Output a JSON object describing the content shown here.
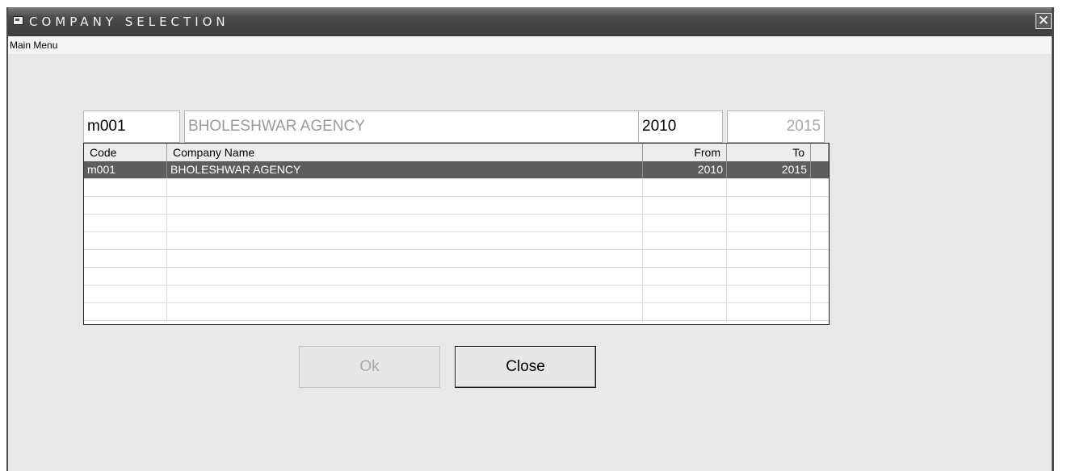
{
  "window": {
    "title": "COMPANY SELECTION",
    "close_glyph": "✕"
  },
  "menu": {
    "items": [
      "Main Menu"
    ]
  },
  "fields": {
    "code": "m001",
    "name": "BHOLESHWAR AGENCY",
    "from": "2010",
    "to": "2015"
  },
  "grid": {
    "columns": [
      "Code",
      "Company Name",
      "From",
      "To"
    ],
    "rows": [
      {
        "code": "m001",
        "name": "BHOLESHWAR AGENCY",
        "from": "2010",
        "to": "2015",
        "selected": true
      }
    ],
    "empty_rows": 8
  },
  "buttons": {
    "ok": "Ok",
    "close": "Close"
  },
  "icons": {
    "title": "app-window-icon",
    "close": "close-icon"
  },
  "colors": {
    "selection": "#5d5d5d",
    "titlebar": "#4a4a4a",
    "background": "#e8e8e8"
  }
}
